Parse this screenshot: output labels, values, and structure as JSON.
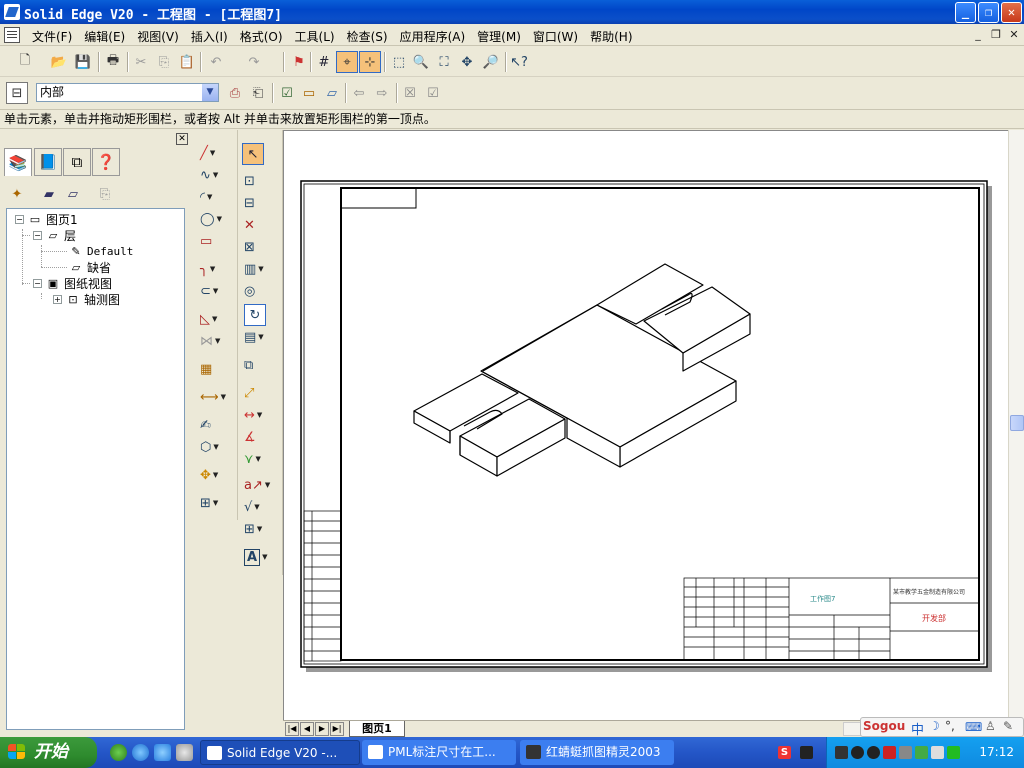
{
  "window": {
    "title": "Solid Edge V20 - 工程图 - [工程图7]",
    "buttons": {
      "minimize": "_",
      "maximize": "❐",
      "close": "✕"
    }
  },
  "menubar": {
    "items": [
      "文件(F)",
      "编辑(E)",
      "视图(V)",
      "插入(I)",
      "格式(O)",
      "工具(L)",
      "检查(S)",
      "应用程序(A)",
      "管理(M)",
      "窗口(W)",
      "帮助(H)"
    ],
    "mdi": {
      "minimize": "_",
      "restore": "❐",
      "close": "✕"
    }
  },
  "layer_toolbar": {
    "selected_layer": "内部"
  },
  "prompt": {
    "text": "单击元素，单击并拖动矩形围栏，或者按 Alt 并单击来放置矩形围栏的第一顶点。"
  },
  "tree": {
    "items": [
      {
        "label": "图页1",
        "icon": "sheet-icon"
      },
      {
        "label": "层",
        "icon": "layer-icon"
      },
      {
        "label": "Default",
        "icon": "layer-item-icon"
      },
      {
        "label": "缺省",
        "icon": "layer-item-icon"
      },
      {
        "label": "图纸视图",
        "icon": "drawing-view-icon"
      },
      {
        "label": "轴测图",
        "icon": "view-icon"
      }
    ]
  },
  "titleblock": {
    "drawing_name": "工作图7",
    "company": "某市教学五金制造有限公司",
    "department": "开发部"
  },
  "sheetbar": {
    "tab": "图页1"
  },
  "taskbar": {
    "start": "开始",
    "tasks": [
      "Solid Edge V20 -...",
      "PML标注尺寸在工...",
      "红蜻蜓抓图精灵2003"
    ],
    "clock": "17:12"
  },
  "sogou": {
    "logo": "Sogou",
    "mode": "中"
  },
  "colors": {
    "titlebar": "#0a5fd8",
    "taskbar": "#2456c7",
    "start": "#2e8b2e",
    "tray": "#0f8ae0",
    "chrome": "#ece9d8"
  }
}
